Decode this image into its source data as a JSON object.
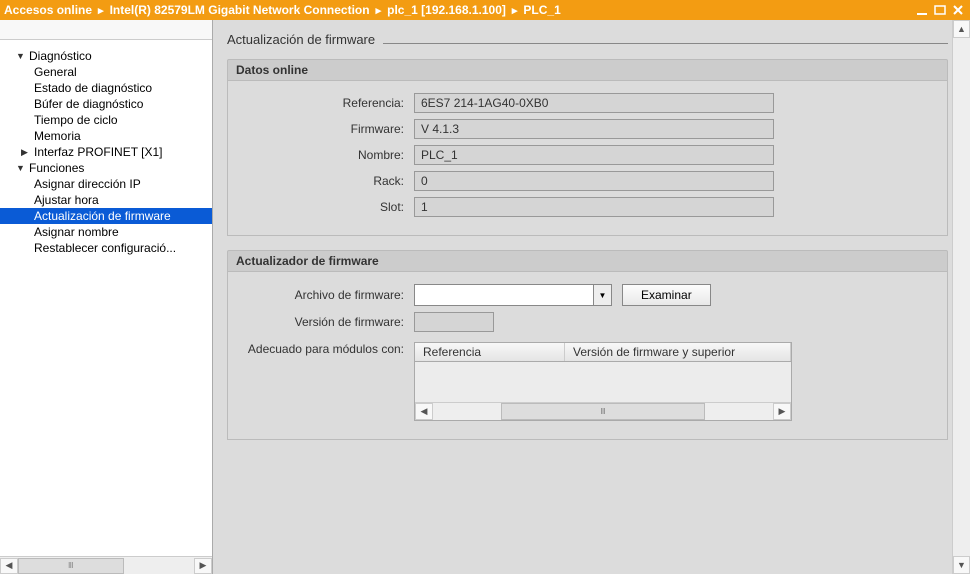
{
  "titlebar": {
    "crumbs": [
      "Accesos online",
      "Intel(R) 82579LM Gigabit Network Connection",
      "plc_1 [192.168.1.100]",
      "PLC_1"
    ]
  },
  "tree": {
    "diagnostico": {
      "label": "Diagnóstico",
      "children": {
        "general": "General",
        "estado": "Estado de diagnóstico",
        "bufer": "Búfer de diagnóstico",
        "ciclo": "Tiempo de ciclo",
        "memoria": "Memoria",
        "profinet": "Interfaz PROFINET [X1]"
      }
    },
    "funciones": {
      "label": "Funciones",
      "children": {
        "ip": "Asignar dirección IP",
        "hora": "Ajustar hora",
        "firmware": "Actualización de firmware",
        "nombre": "Asignar nombre",
        "reset": "Restablecer configuració..."
      }
    }
  },
  "page": {
    "title": "Actualización de firmware",
    "online": {
      "header": "Datos online",
      "fields": {
        "referencia_label": "Referencia:",
        "referencia": "6ES7 214-1AG40-0XB0",
        "firmware_label": "Firmware:",
        "firmware": "V 4.1.3",
        "nombre_label": "Nombre:",
        "nombre": "PLC_1",
        "rack_label": "Rack:",
        "rack": "0",
        "slot_label": "Slot:",
        "slot": "1"
      }
    },
    "updater": {
      "header": "Actualizador de firmware",
      "archivo_label": "Archivo de firmware:",
      "examinar": "Examinar",
      "version_label": "Versión de firmware:",
      "adecuado_label": "Adecuado para módulos con:",
      "grid": {
        "col1": "Referencia",
        "col2": "Versión de firmware y superior"
      }
    }
  }
}
